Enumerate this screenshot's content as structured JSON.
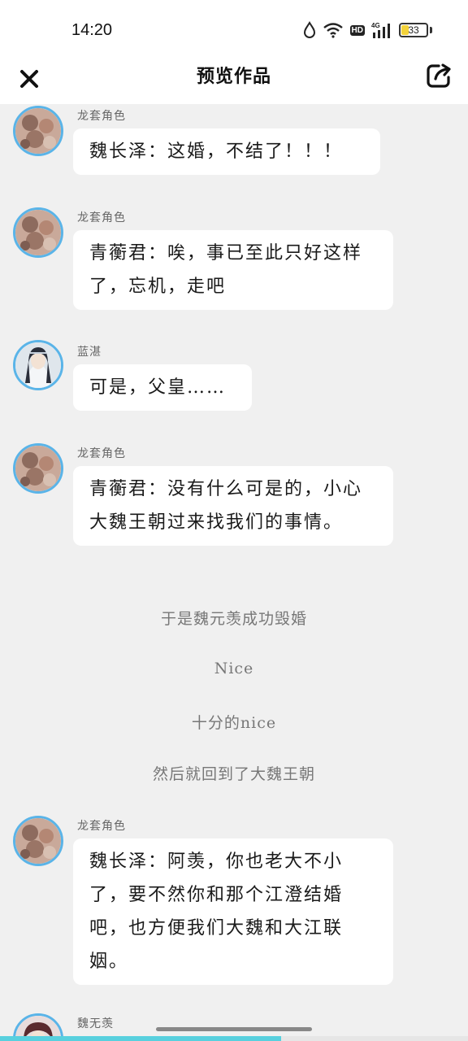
{
  "status_bar": {
    "time": "14:20",
    "network_label": "4G",
    "hd_label": "HD",
    "battery_level": "33",
    "icons": [
      "drop-icon",
      "wifi-icon",
      "hd-icon",
      "signal-icon",
      "battery-icon"
    ]
  },
  "nav": {
    "title": "预览作品",
    "close_icon": "close-icon",
    "share_icon": "share-icon"
  },
  "messages": [
    {
      "speaker": "龙套角色",
      "text": "魏长泽：这婚，不结了！！！",
      "avatar": "avatar-extra-role"
    },
    {
      "speaker": "龙套角色",
      "text": "青蘅君：唉，事已至此只好这样了，忘机，走吧",
      "avatar": "avatar-extra-role"
    },
    {
      "speaker": "蓝湛",
      "text": "可是，父皇……",
      "avatar": "avatar-lan-zhan"
    },
    {
      "speaker": "龙套角色",
      "text": "青蘅君：没有什么可是的，小心大魏王朝过来找我们的事情。",
      "avatar": "avatar-extra-role"
    },
    {
      "speaker": "龙套角色",
      "text": "魏长泽：阿羡，你也老大不小了，要不然你和那个江澄结婚吧，也方便我们大魏和大江联姻。",
      "avatar": "avatar-extra-role"
    },
    {
      "speaker": "魏无羡",
      "text": "",
      "avatar": "avatar-wei-wuxian"
    }
  ],
  "narrations": [
    "于是魏元羡成功毁婚",
    "Nice",
    "十分的nice",
    "然后就回到了大魏王朝"
  ],
  "theme": {
    "accent": "#5ab4e8",
    "progress": "#58d0de",
    "battery": "#f3d23a"
  },
  "reading_progress": 0.6
}
